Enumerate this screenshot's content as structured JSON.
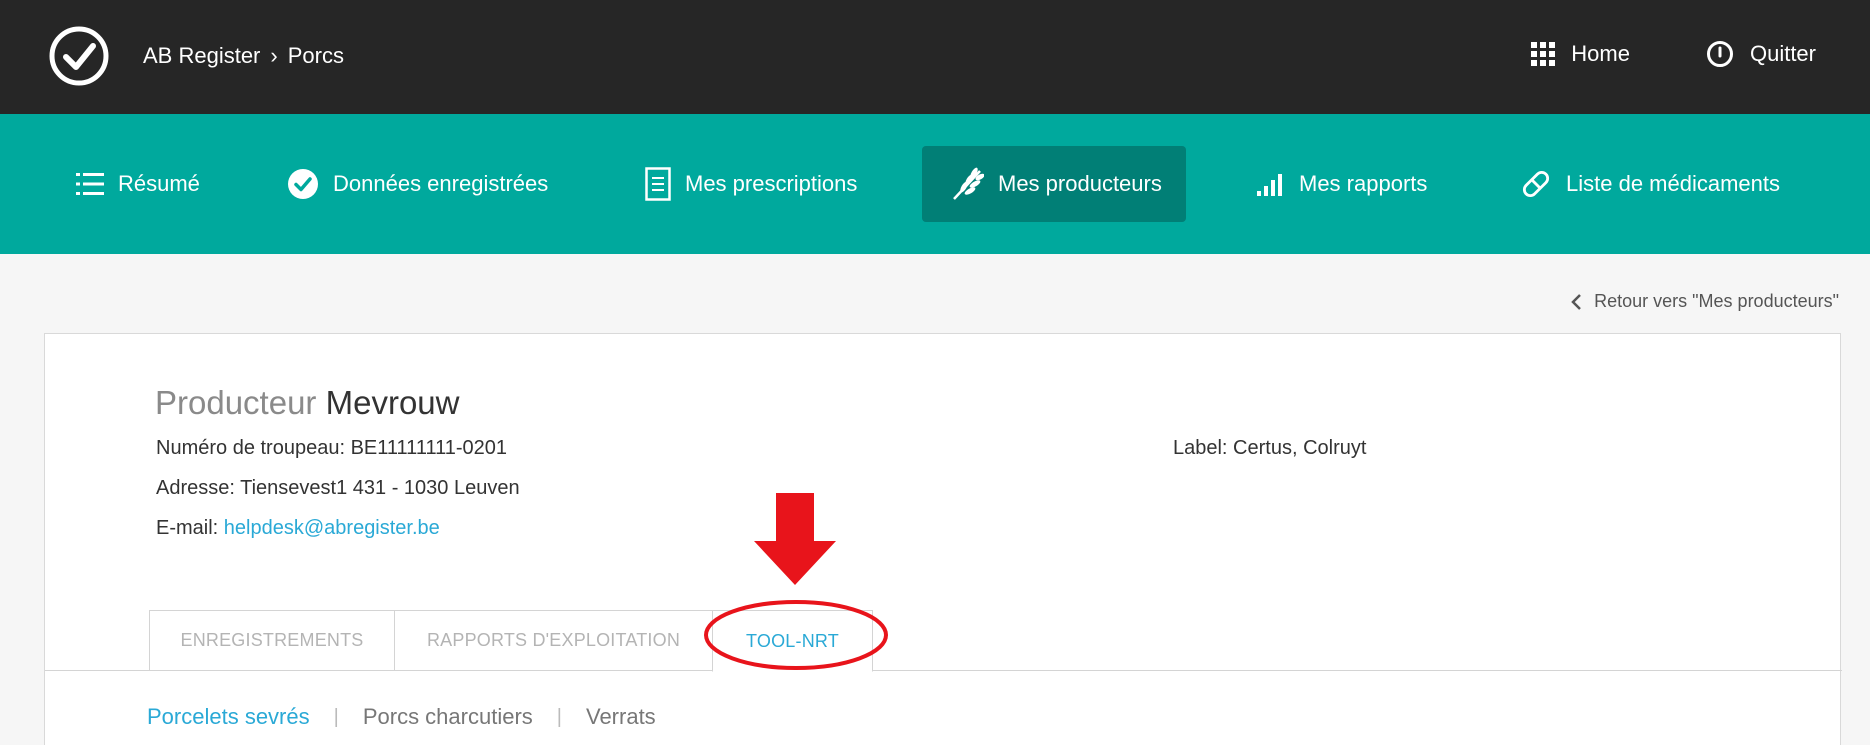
{
  "header": {
    "breadcrumb": [
      "AB Register",
      "Porcs"
    ],
    "breadcrumb_separator": "›",
    "home_label": "Home",
    "quit_label": "Quitter"
  },
  "nav": {
    "items": [
      {
        "label": "Résumé",
        "icon": "list-icon"
      },
      {
        "label": "Données enregistrées",
        "icon": "check-circle-icon"
      },
      {
        "label": "Mes prescriptions",
        "icon": "document-icon"
      },
      {
        "label": "Mes producteurs",
        "icon": "wheat-icon",
        "active": true
      },
      {
        "label": "Mes rapports",
        "icon": "signal-bars-icon"
      },
      {
        "label": "Liste de médicaments",
        "icon": "pill-icon"
      }
    ]
  },
  "back_link": "Retour vers \"Mes producteurs\"",
  "producer": {
    "title_label": "Producteur",
    "name": "Mevrouw",
    "herd_label": "Numéro de troupeau:",
    "herd_number": "BE11111111-0201",
    "address_label": "Adresse:",
    "address": "Tiensevest1 431 - 1030 Leuven",
    "email_label": "E-mail:",
    "email": "helpdesk@abregister.be",
    "label_text": "Label: Certus, Colruyt"
  },
  "tabs": [
    {
      "label": "ENREGISTREMENTS",
      "active": false
    },
    {
      "label": "RAPPORTS D'EXPLOITATION",
      "active": false
    },
    {
      "label": "TOOL-NRT",
      "active": true
    }
  ],
  "subtabs": [
    {
      "label": "Porcelets sevrés",
      "active": true
    },
    {
      "label": "Porcs charcutiers",
      "active": false
    },
    {
      "label": "Verrats",
      "active": false
    }
  ],
  "subtab_separator": "|",
  "colors": {
    "topbar": "#262626",
    "nav": "#00a99d",
    "nav_active": "#017f76",
    "accent": "#2aa9d6",
    "annotation": "#e8141b"
  }
}
